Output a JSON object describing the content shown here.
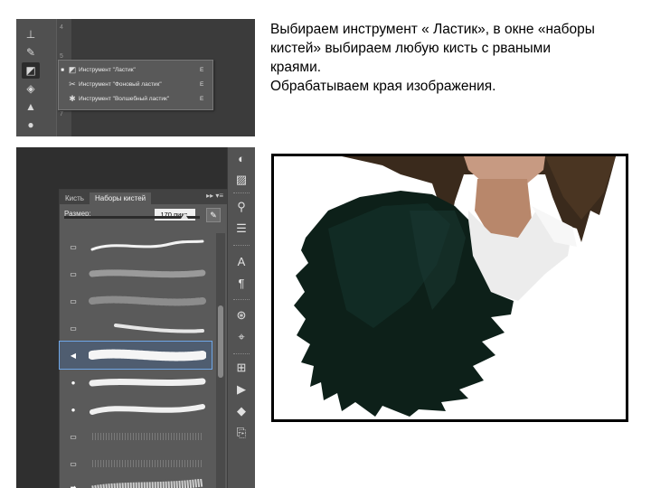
{
  "instructions": {
    "line1": "Выбираем инструмент « Ластик», в окне «наборы",
    "line2": " кистей» выбираем любую кисть  с рваными",
    "line3": "краями.",
    "line4": "Обрабатываем края изображения."
  },
  "tool_flyout": {
    "ruler_marks": [
      "4",
      "5",
      "6",
      "7"
    ],
    "items": [
      {
        "label": "Инструмент \"Ластик\"",
        "key": "E",
        "active": true,
        "icon": "eraser-icon"
      },
      {
        "label": "Инструмент \"Фоновый ластик\"",
        "key": "E",
        "active": false,
        "icon": "background-eraser-icon"
      },
      {
        "label": "Инструмент \"Волшебный ластик\"",
        "key": "E",
        "active": false,
        "icon": "magic-eraser-icon"
      }
    ]
  },
  "brush_panel": {
    "tabs": [
      "Кисть",
      "Наборы кистей"
    ],
    "active_tab": "Наборы кистей",
    "size_label": "Размер:",
    "size_value": "170 пикс.",
    "controls": "▸▸ ▾≡",
    "selected_preset_index": 4
  },
  "colors": {
    "ps_dark": "#2f2f2f",
    "panel": "#5a5a5a",
    "selection": "#6fa6e6",
    "jacket": "#0d2019"
  }
}
